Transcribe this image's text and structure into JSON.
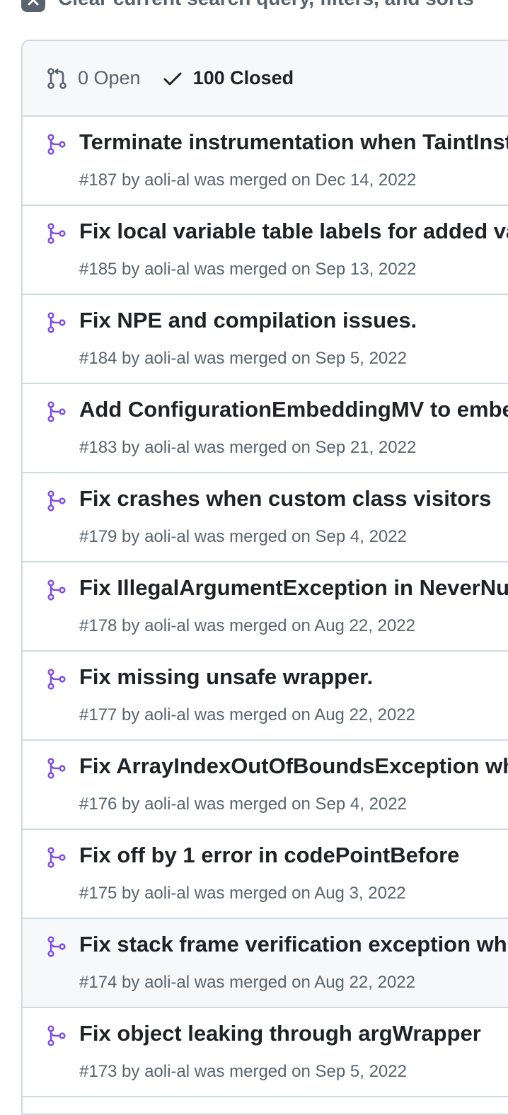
{
  "clear_filters": {
    "label": "Clear current search query, filters, and sorts"
  },
  "header": {
    "open_label": "0 Open",
    "closed_label": "100 Closed"
  },
  "accent_color": "#8250df",
  "pull_requests": [
    {
      "title": "Terminate instrumentation when TaintInstrumentation",
      "meta": "#187 by aoli-al was merged on Dec 14, 2022"
    },
    {
      "title": "Fix local variable table labels for added variables",
      "meta": "#185 by aoli-al was merged on Sep 13, 2022"
    },
    {
      "title": "Fix NPE and compilation issues.",
      "meta": "#184 by aoli-al was merged on Sep 5, 2022"
    },
    {
      "title": "Add ConfigurationEmbeddingMV to embedding",
      "meta": "#183 by aoli-al was merged on Sep 21, 2022"
    },
    {
      "title": "Fix crashes when custom class visitors",
      "meta": "#179 by aoli-al was merged on Sep 4, 2022"
    },
    {
      "title": "Fix IllegalArgumentException in NeverNullArgAnalyzer",
      "meta": "#178 by aoli-al was merged on Aug 22, 2022"
    },
    {
      "title": "Fix missing unsafe wrapper.",
      "meta": "#177 by aoli-al was merged on Aug 22, 2022"
    },
    {
      "title": "Fix ArrayIndexOutOfBoundsException when",
      "meta": "#176 by aoli-al was merged on Sep 4, 2022"
    },
    {
      "title": "Fix off by 1 error in codePointBefore",
      "meta": "#175 by aoli-al was merged on Aug 3, 2022"
    },
    {
      "title": "Fix stack frame verification exception when",
      "meta": "#174 by aoli-al was merged on Aug 22, 2022"
    },
    {
      "title": "Fix object leaking through argWrapper",
      "meta": "#173 by aoli-al was merged on Sep 5, 2022"
    }
  ]
}
